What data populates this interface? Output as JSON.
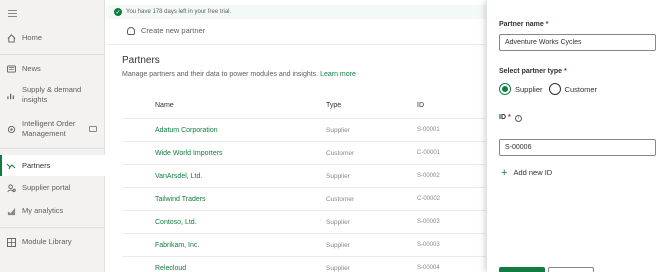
{
  "sidebar": {
    "items": [
      {
        "label": "Home",
        "icon": "home-icon"
      },
      {
        "label": "News",
        "icon": "news-icon"
      },
      {
        "label": "Supply & demand insights",
        "icon": "chart-icon"
      },
      {
        "label": "Intelligent Order Management",
        "icon": "order-icon"
      },
      {
        "label": "Partners",
        "icon": "partners-icon",
        "active": true
      },
      {
        "label": "Supplier portal",
        "icon": "supplier-portal-icon"
      },
      {
        "label": "My analytics",
        "icon": "analytics-icon"
      },
      {
        "label": "Module Library",
        "icon": "module-library-icon"
      }
    ]
  },
  "banner": {
    "text": "You have 178 days left in your free trial."
  },
  "command": {
    "create_label": "Create new partner"
  },
  "page": {
    "title": "Partners",
    "subtitle": "Manage partners and their data to power modules and insights.",
    "learn_more": "Learn more"
  },
  "table": {
    "headers": {
      "name": "Name",
      "type": "Type",
      "id": "ID"
    },
    "rows": [
      {
        "name": "Adatum Corporation",
        "type": "Supplier",
        "id": "S-00001"
      },
      {
        "name": "Wide World Importers",
        "type": "Customer",
        "id": "C-00001"
      },
      {
        "name": "VanArsdel, Ltd.",
        "type": "Supplier",
        "id": "S-00002"
      },
      {
        "name": "Tailwind Traders",
        "type": "Customer",
        "id": "C-00002"
      },
      {
        "name": "Contoso, Ltd.",
        "type": "Supplier",
        "id": "S-00003"
      },
      {
        "name": "Fabrikam, Inc.",
        "type": "Supplier",
        "id": "S-00003"
      },
      {
        "name": "Relecloud",
        "type": "Supplier",
        "id": "S-00004"
      }
    ]
  },
  "panel": {
    "partner_name_label": "Partner name",
    "partner_name_value": "Adventure Works Cycles",
    "partner_type_label": "Select partner type",
    "type_options": [
      "Supplier",
      "Customer"
    ],
    "selected_type": "Supplier",
    "id_label": "ID",
    "id_value": "S-00006",
    "add_id_label": "Add new ID",
    "required_mark": "*"
  },
  "colors": {
    "accent": "#107c41",
    "required": "#a4262c"
  }
}
